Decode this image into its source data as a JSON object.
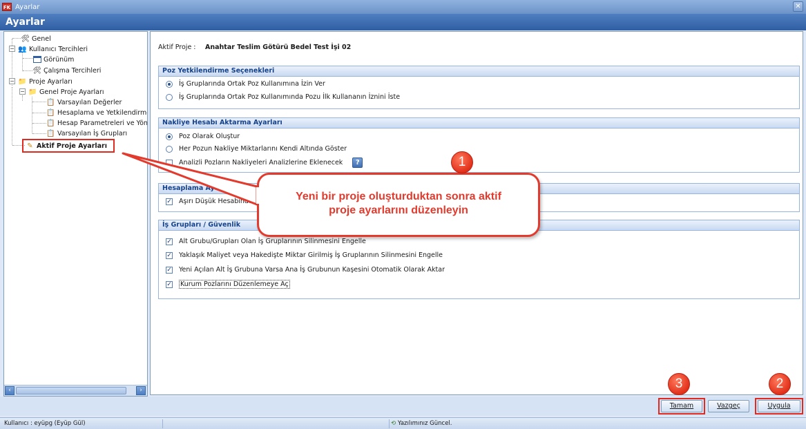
{
  "window": {
    "title": "Ayarlar",
    "app_icon_text": "FK"
  },
  "header": {
    "title": "Ayarlar"
  },
  "tree": {
    "items": [
      {
        "label": "Genel",
        "icon": "tools-icon"
      },
      {
        "label": "Kullanıcı Tercihleri",
        "icon": "users-icon"
      },
      {
        "label": "Görünüm",
        "icon": "window-icon"
      },
      {
        "label": "Çalışma Tercihleri",
        "icon": "tools-icon"
      },
      {
        "label": "Proje Ayarları",
        "icon": "folder-icon"
      },
      {
        "label": "Genel Proje Ayarları",
        "icon": "folder-icon"
      },
      {
        "label": "Varsayılan Değerler",
        "icon": "clipboard-icon"
      },
      {
        "label": "Hesaplama ve Yetkilendirme",
        "icon": "clipboard-icon"
      },
      {
        "label": "Hesap Parametreleri ve Yönt",
        "icon": "clipboard-icon"
      },
      {
        "label": "Varsayılan İş Grupları",
        "icon": "clipboard-icon"
      },
      {
        "label": "Aktif Proje Ayarları",
        "icon": "edit-icon"
      }
    ]
  },
  "main": {
    "project_label": "Aktif Proje :",
    "project_value": "Anahtar Teslim Götürü Bedel Test İşi 02",
    "groups": [
      {
        "title": "Poz Yetkilendirme Seçenekleri",
        "options": [
          {
            "type": "radio",
            "checked": true,
            "label": "İş Gruplarında Ortak Poz Kullanımına İzin Ver"
          },
          {
            "type": "radio",
            "checked": false,
            "label": "İş Gruplarında Ortak Poz Kullanımında Pozu İlk Kullananın İznini İste"
          }
        ]
      },
      {
        "title": "Nakliye Hesabı Aktarma Ayarları",
        "options": [
          {
            "type": "radio",
            "checked": true,
            "label": "Poz Olarak Oluştur"
          },
          {
            "type": "radio",
            "checked": false,
            "label": "Her Pozun Nakliye Miktarlarını Kendi Altında Göster"
          },
          {
            "type": "checkbox",
            "checked": false,
            "label": "Analizli Pozların Nakliyeleri Analizlerine Eklenecek",
            "help": "?"
          }
        ]
      },
      {
        "title": "Hesaplama Ayarla",
        "options": [
          {
            "type": "checkbox",
            "checked": true,
            "label": "Aşırı Düşük Hesabında"
          }
        ]
      },
      {
        "title": "İş Grupları / Güvenlik",
        "options": [
          {
            "type": "checkbox",
            "checked": true,
            "label": "Alt Grubu/Grupları Olan İş Gruplarının Silinmesini Engelle"
          },
          {
            "type": "checkbox",
            "checked": true,
            "label": "Yaklaşık Maliyet veya Hakedişte Miktar Girilmiş İş Gruplarının Silinmesini Engelle"
          },
          {
            "type": "checkbox",
            "checked": true,
            "label": "Yeni Açılan Alt İş Grubuna Varsa Ana İş Grubunun Kaşesini Otomatik Olarak Aktar"
          },
          {
            "type": "checkbox",
            "checked": true,
            "label": "Kurum Pozlarını Düzenlemeye Aç"
          }
        ]
      }
    ]
  },
  "annotation": {
    "callout_line1": "Yeni bir proje oluşturduktan sonra aktif",
    "callout_line2": "proje ayarlarını düzenleyin",
    "badge1": "1",
    "badge2": "2",
    "badge3": "3",
    "color": "#e23a2d"
  },
  "buttons": {
    "ok": "Tamam",
    "cancel": "Vazgeç",
    "apply": "Uygula"
  },
  "status": {
    "user": "Kullanıcı : eyüpg  (Eyüp Gül)",
    "update": "Yazılımınız Güncel."
  }
}
